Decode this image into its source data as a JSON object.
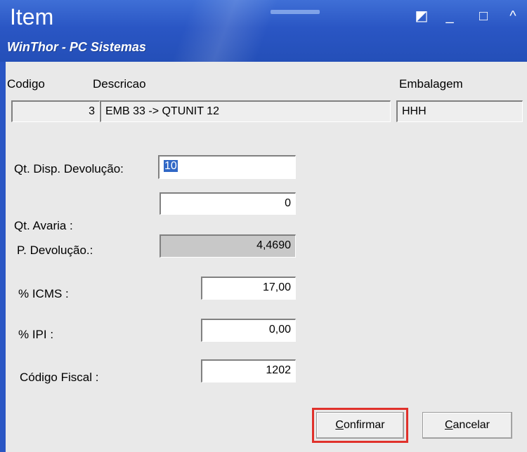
{
  "window": {
    "title": "Item",
    "subtitle": "WinThor - PC Sistemas",
    "controls": {
      "minimize": "_",
      "restore": "◩",
      "maximize": "□",
      "collapse": "^"
    }
  },
  "header_fields": {
    "codigo": {
      "label": "Codigo",
      "value": "3"
    },
    "descricao": {
      "label": "Descricao",
      "value": "EMB 33 -> QTUNIT 12"
    },
    "embalagem": {
      "label": "Embalagem",
      "value": "HHH"
    }
  },
  "form": {
    "qt_disp_devolucao": {
      "label": "Qt. Disp. Devolução:",
      "value": "10"
    },
    "qt_avaria": {
      "label": "Qt. Avaria :",
      "value": "0"
    },
    "p_devolucao": {
      "label": "P. Devolução.:",
      "value": "4,4690"
    },
    "icms": {
      "label": "% ICMS :",
      "value": "17,00"
    },
    "ipi": {
      "label": "% IPI :",
      "value": "0,00"
    },
    "codigo_fiscal": {
      "label": "Código Fiscal :",
      "value": "1202"
    }
  },
  "buttons": {
    "confirmar": {
      "mnemonic": "C",
      "rest": "onfirmar"
    },
    "cancelar": {
      "mnemonic": "C",
      "rest": "ancelar"
    }
  },
  "colors": {
    "titlebar": "#2a56c4",
    "highlight": "#e0312b",
    "selection": "#3168c6"
  }
}
